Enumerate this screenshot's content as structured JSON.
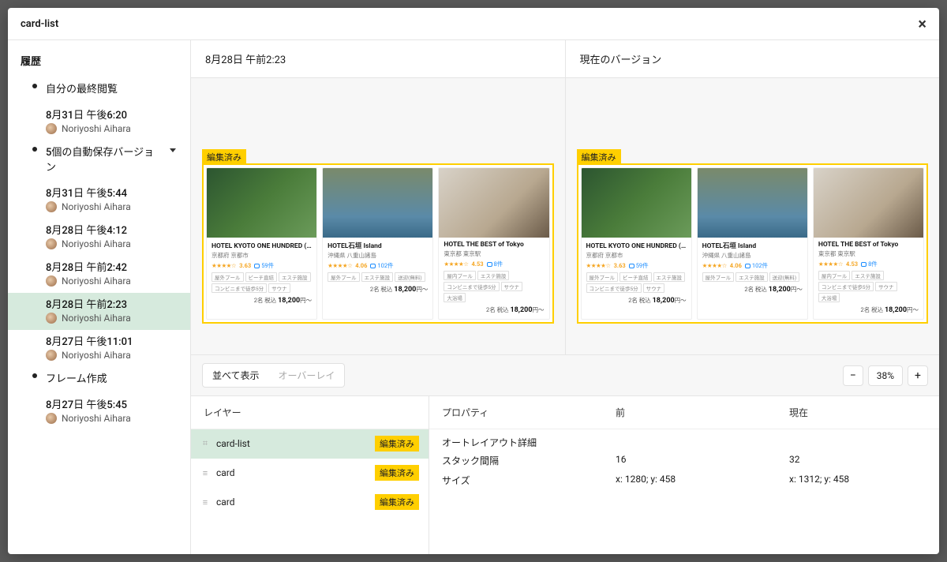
{
  "header": {
    "title": "card-list"
  },
  "sidebar": {
    "title": "履歴",
    "groups": [
      {
        "label": "自分の最終閲覧",
        "dot": true,
        "items": [
          {
            "time": "8月31日 午後6:20",
            "author": "Noriyoshi Aihara"
          }
        ]
      },
      {
        "label": "5個の自動保存バージョン",
        "dot": true,
        "caret": true,
        "items": [
          {
            "time": "8月31日 午後5:44",
            "author": "Noriyoshi Aihara"
          },
          {
            "time": "8月28日 午後4:12",
            "author": "Noriyoshi Aihara"
          },
          {
            "time": "8月28日 午前2:42",
            "author": "Noriyoshi Aihara"
          },
          {
            "time": "8月28日 午前2:23",
            "author": "Noriyoshi Aihara",
            "selected": true
          },
          {
            "time": "8月27日 午後11:01",
            "author": "Noriyoshi Aihara"
          }
        ]
      },
      {
        "label": "フレーム作成",
        "dot": true,
        "items": [
          {
            "time": "8月27日 午後5:45",
            "author": "Noriyoshi Aihara"
          }
        ]
      }
    ]
  },
  "compare": {
    "left_title": "8月28日 午前2:23",
    "right_title": "現在のバージョン",
    "edited_label": "編集済み",
    "cards": [
      {
        "name": "HOTEL KYOTO ONE HUNDRED (ホテル…",
        "loc": "京都府 京都市",
        "rating": "3.63",
        "reviews": "59件",
        "price_prefix": "2名 税込",
        "price": "18,200",
        "price_suffix": "円〜",
        "img": "img-forest",
        "tags": [
          "屋外プール",
          "ビーチ直結",
          "エステ施設",
          "コンビニまで徒歩5分",
          "サウナ"
        ]
      },
      {
        "name": "HOTEL石垣 Island",
        "loc": "沖縄県 八重山諸島",
        "rating": "4.06",
        "reviews": "102件",
        "price_prefix": "2名 税込",
        "price": "18,200",
        "price_suffix": "円〜",
        "img": "img-pool",
        "tags": [
          "屋外プール",
          "エステ施設",
          "送迎(無料)"
        ]
      },
      {
        "name": "HOTEL THE BEST of Tokyo",
        "loc": "東京都 東京駅",
        "rating": "4.53",
        "reviews": "8件",
        "price_prefix": "2名 税込",
        "price": "18,200",
        "price_suffix": "円〜",
        "img": "img-room",
        "tags": [
          "屋内プール",
          "エステ施設",
          "コンビニまで徒歩5分",
          "サウナ",
          "大浴場"
        ]
      }
    ]
  },
  "toolbar": {
    "side_by_side": "並べて表示",
    "overlay": "オーバーレイ",
    "zoom": "38%"
  },
  "layers": {
    "title": "レイヤー",
    "items": [
      {
        "name": "card-list",
        "badge": "編集済み",
        "selected": true,
        "icon": "⌗"
      },
      {
        "name": "card",
        "badge": "編集済み",
        "icon": "≡"
      },
      {
        "name": "card",
        "badge": "編集済み",
        "icon": "≡"
      }
    ]
  },
  "props": {
    "col_property": "プロパティ",
    "col_before": "前",
    "col_after": "現在",
    "section": "オートレイアウト詳細",
    "rows": [
      {
        "label": "スタック間隔",
        "before": "16",
        "after": "32"
      },
      {
        "label": "サイズ",
        "before": "x: 1280; y: 458",
        "after": "x: 1312; y: 458"
      }
    ]
  }
}
